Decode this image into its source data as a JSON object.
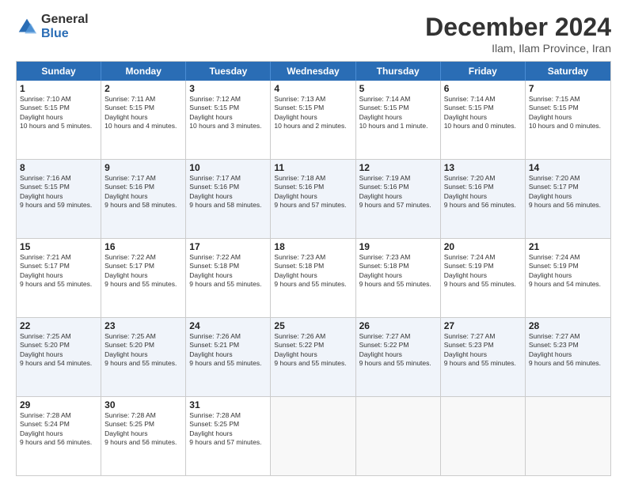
{
  "logo": {
    "general": "General",
    "blue": "Blue"
  },
  "header": {
    "month": "December 2024",
    "location": "Ilam, Ilam Province, Iran"
  },
  "days": [
    "Sunday",
    "Monday",
    "Tuesday",
    "Wednesday",
    "Thursday",
    "Friday",
    "Saturday"
  ],
  "rows": [
    [
      {
        "day": 1,
        "sunrise": "7:10 AM",
        "sunset": "5:15 PM",
        "daylight": "10 hours and 5 minutes."
      },
      {
        "day": 2,
        "sunrise": "7:11 AM",
        "sunset": "5:15 PM",
        "daylight": "10 hours and 4 minutes."
      },
      {
        "day": 3,
        "sunrise": "7:12 AM",
        "sunset": "5:15 PM",
        "daylight": "10 hours and 3 minutes."
      },
      {
        "day": 4,
        "sunrise": "7:13 AM",
        "sunset": "5:15 PM",
        "daylight": "10 hours and 2 minutes."
      },
      {
        "day": 5,
        "sunrise": "7:14 AM",
        "sunset": "5:15 PM",
        "daylight": "10 hours and 1 minute."
      },
      {
        "day": 6,
        "sunrise": "7:14 AM",
        "sunset": "5:15 PM",
        "daylight": "10 hours and 0 minutes."
      },
      {
        "day": 7,
        "sunrise": "7:15 AM",
        "sunset": "5:15 PM",
        "daylight": "10 hours and 0 minutes."
      }
    ],
    [
      {
        "day": 8,
        "sunrise": "7:16 AM",
        "sunset": "5:15 PM",
        "daylight": "9 hours and 59 minutes."
      },
      {
        "day": 9,
        "sunrise": "7:17 AM",
        "sunset": "5:16 PM",
        "daylight": "9 hours and 58 minutes."
      },
      {
        "day": 10,
        "sunrise": "7:17 AM",
        "sunset": "5:16 PM",
        "daylight": "9 hours and 58 minutes."
      },
      {
        "day": 11,
        "sunrise": "7:18 AM",
        "sunset": "5:16 PM",
        "daylight": "9 hours and 57 minutes."
      },
      {
        "day": 12,
        "sunrise": "7:19 AM",
        "sunset": "5:16 PM",
        "daylight": "9 hours and 57 minutes."
      },
      {
        "day": 13,
        "sunrise": "7:20 AM",
        "sunset": "5:16 PM",
        "daylight": "9 hours and 56 minutes."
      },
      {
        "day": 14,
        "sunrise": "7:20 AM",
        "sunset": "5:17 PM",
        "daylight": "9 hours and 56 minutes."
      }
    ],
    [
      {
        "day": 15,
        "sunrise": "7:21 AM",
        "sunset": "5:17 PM",
        "daylight": "9 hours and 55 minutes."
      },
      {
        "day": 16,
        "sunrise": "7:22 AM",
        "sunset": "5:17 PM",
        "daylight": "9 hours and 55 minutes."
      },
      {
        "day": 17,
        "sunrise": "7:22 AM",
        "sunset": "5:18 PM",
        "daylight": "9 hours and 55 minutes."
      },
      {
        "day": 18,
        "sunrise": "7:23 AM",
        "sunset": "5:18 PM",
        "daylight": "9 hours and 55 minutes."
      },
      {
        "day": 19,
        "sunrise": "7:23 AM",
        "sunset": "5:18 PM",
        "daylight": "9 hours and 55 minutes."
      },
      {
        "day": 20,
        "sunrise": "7:24 AM",
        "sunset": "5:19 PM",
        "daylight": "9 hours and 55 minutes."
      },
      {
        "day": 21,
        "sunrise": "7:24 AM",
        "sunset": "5:19 PM",
        "daylight": "9 hours and 54 minutes."
      }
    ],
    [
      {
        "day": 22,
        "sunrise": "7:25 AM",
        "sunset": "5:20 PM",
        "daylight": "9 hours and 54 minutes."
      },
      {
        "day": 23,
        "sunrise": "7:25 AM",
        "sunset": "5:20 PM",
        "daylight": "9 hours and 55 minutes."
      },
      {
        "day": 24,
        "sunrise": "7:26 AM",
        "sunset": "5:21 PM",
        "daylight": "9 hours and 55 minutes."
      },
      {
        "day": 25,
        "sunrise": "7:26 AM",
        "sunset": "5:22 PM",
        "daylight": "9 hours and 55 minutes."
      },
      {
        "day": 26,
        "sunrise": "7:27 AM",
        "sunset": "5:22 PM",
        "daylight": "9 hours and 55 minutes."
      },
      {
        "day": 27,
        "sunrise": "7:27 AM",
        "sunset": "5:23 PM",
        "daylight": "9 hours and 55 minutes."
      },
      {
        "day": 28,
        "sunrise": "7:27 AM",
        "sunset": "5:23 PM",
        "daylight": "9 hours and 56 minutes."
      }
    ],
    [
      {
        "day": 29,
        "sunrise": "7:28 AM",
        "sunset": "5:24 PM",
        "daylight": "9 hours and 56 minutes."
      },
      {
        "day": 30,
        "sunrise": "7:28 AM",
        "sunset": "5:25 PM",
        "daylight": "9 hours and 56 minutes."
      },
      {
        "day": 31,
        "sunrise": "7:28 AM",
        "sunset": "5:25 PM",
        "daylight": "9 hours and 57 minutes."
      },
      null,
      null,
      null,
      null
    ]
  ]
}
